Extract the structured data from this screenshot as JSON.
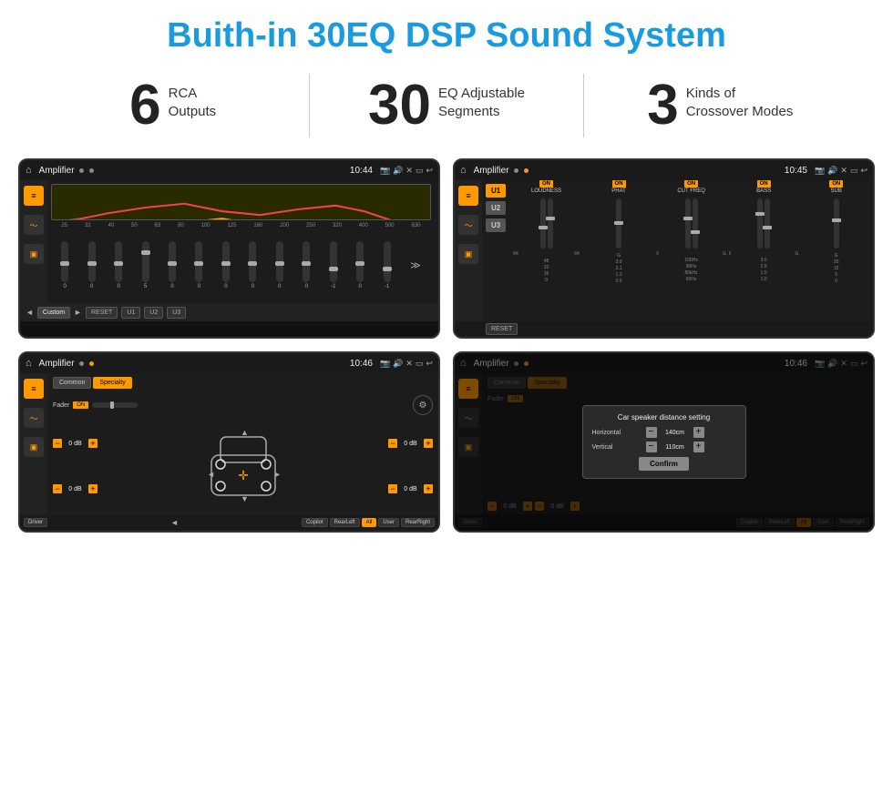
{
  "header": {
    "title": "Buith-in 30EQ DSP Sound System"
  },
  "stats": [
    {
      "number": "6",
      "line1": "RCA",
      "line2": "Outputs"
    },
    {
      "number": "30",
      "line1": "EQ Adjustable",
      "line2": "Segments"
    },
    {
      "number": "3",
      "line1": "Kinds of",
      "line2": "Crossover Modes"
    }
  ],
  "screens": [
    {
      "id": "eq-screen",
      "topbar": {
        "title": "Amplifier",
        "time": "10:44"
      },
      "type": "eq"
    },
    {
      "id": "amp-screen",
      "topbar": {
        "title": "Amplifier",
        "time": "10:45"
      },
      "type": "amp"
    },
    {
      "id": "speaker-screen",
      "topbar": {
        "title": "Amplifier",
        "time": "10:46"
      },
      "type": "speaker"
    },
    {
      "id": "dialog-screen",
      "topbar": {
        "title": "Amplifier",
        "time": "10:46"
      },
      "type": "dialog",
      "dialog": {
        "title": "Car speaker distance setting",
        "horizontal_label": "Horizontal",
        "horizontal_value": "140cm",
        "vertical_label": "Vertical",
        "vertical_value": "110cm",
        "confirm_label": "Confirm"
      }
    }
  ],
  "eq": {
    "freq_labels": [
      "25",
      "32",
      "40",
      "50",
      "63",
      "80",
      "100",
      "125",
      "160",
      "200",
      "250",
      "320",
      "400",
      "500",
      "630"
    ],
    "values": [
      "0",
      "0",
      "0",
      "5",
      "0",
      "0",
      "0",
      "0",
      "0",
      "0",
      "-1",
      "0",
      "-1"
    ],
    "buttons": [
      "Custom",
      "RESET",
      "U1",
      "U2",
      "U3"
    ]
  },
  "amp": {
    "u_buttons": [
      "U1",
      "U2",
      "U3"
    ],
    "channels": [
      {
        "label": "LOUDNESS",
        "on": true
      },
      {
        "label": "PHAT",
        "on": true
      },
      {
        "label": "CUT FREQ",
        "on": true
      },
      {
        "label": "BASS",
        "on": true
      },
      {
        "label": "SUB",
        "on": true
      }
    ],
    "reset_label": "RESET"
  },
  "speaker": {
    "tabs": [
      "Common",
      "Specialty"
    ],
    "active_tab": 1,
    "fader_label": "Fader",
    "on_label": "ON",
    "db_values": [
      "0 dB",
      "0 dB",
      "0 dB",
      "0 dB"
    ],
    "bottom_buttons": [
      "Driver",
      "",
      "Copilot",
      "RearLeft",
      "All",
      "User",
      "RearRight"
    ]
  },
  "dialog": {
    "title": "Car speaker distance setting",
    "horizontal_label": "Horizontal",
    "horizontal_value": "140cm",
    "vertical_label": "Vertical",
    "vertical_value": "110cm",
    "confirm_label": "Confirm"
  }
}
